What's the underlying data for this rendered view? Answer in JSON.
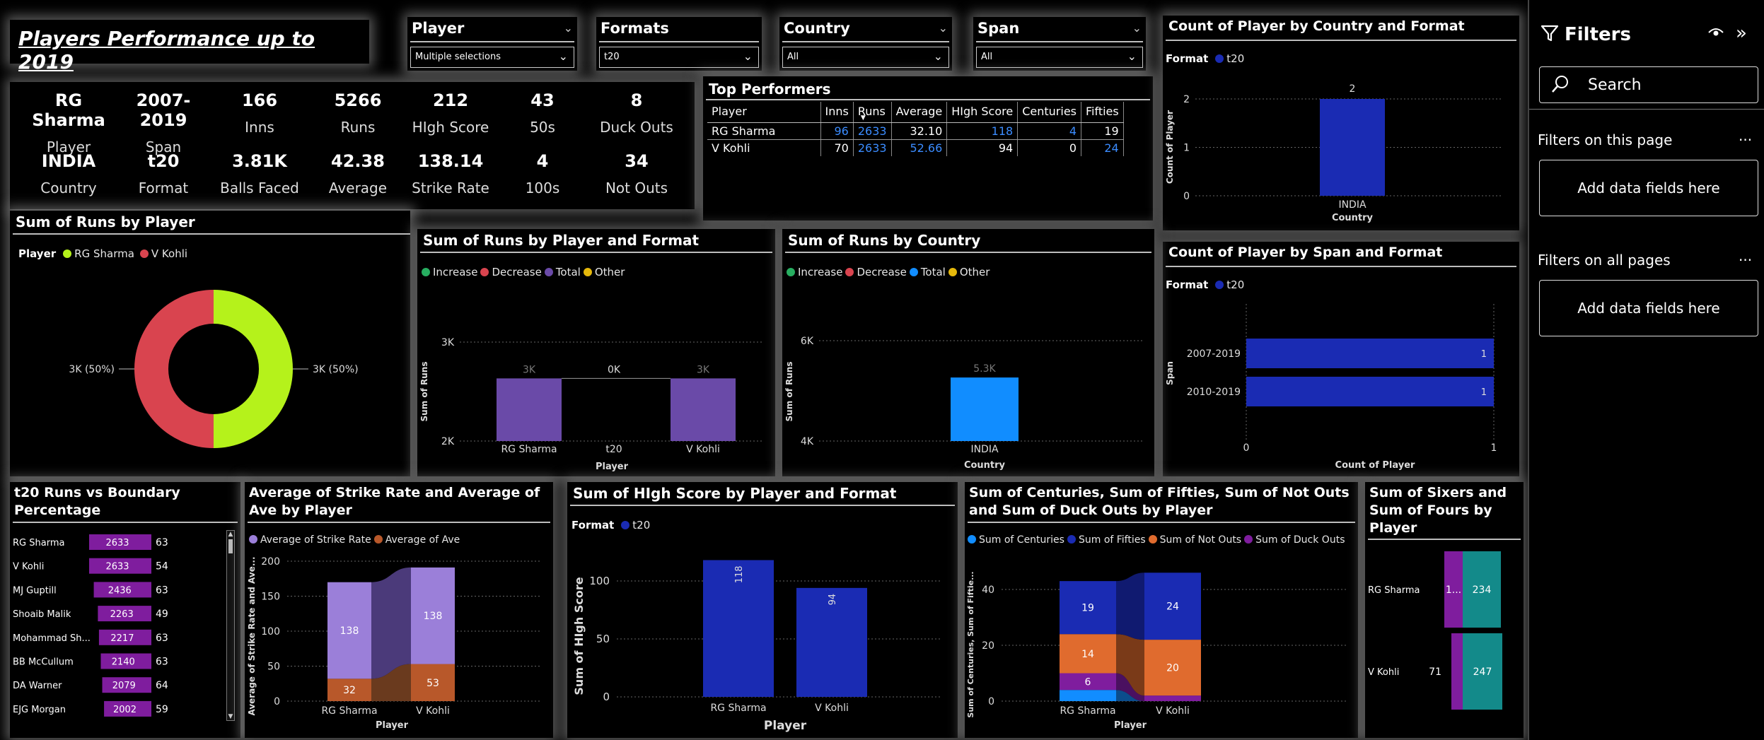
{
  "report_title": "Players Performance up to 2019",
  "slicers": [
    {
      "label": "Player",
      "value": "Multiple selections"
    },
    {
      "label": "Formats",
      "value": "t20"
    },
    {
      "label": "Country",
      "value": "All"
    },
    {
      "label": "Span",
      "value": "All"
    }
  ],
  "kpis_row1": [
    {
      "value": "RG Sharma",
      "label": "Player"
    },
    {
      "value": "2007-2019",
      "label": "Span"
    },
    {
      "value": "166",
      "label": "Inns"
    },
    {
      "value": "5266",
      "label": "Runs"
    },
    {
      "value": "212",
      "label": "HIgh Score"
    },
    {
      "value": "43",
      "label": "50s"
    },
    {
      "value": "8",
      "label": "Duck Outs"
    }
  ],
  "kpis_row2": [
    {
      "value": "INDIA",
      "label": "Country"
    },
    {
      "value": "t20",
      "label": "Format"
    },
    {
      "value": "3.81K",
      "label": "Balls Faced"
    },
    {
      "value": "42.38",
      "label": "Average"
    },
    {
      "value": "138.14",
      "label": "Strike Rate"
    },
    {
      "value": "4",
      "label": "100s"
    },
    {
      "value": "34",
      "label": "Not Outs"
    }
  ],
  "top_performers": {
    "title": "Top Performers",
    "headers": [
      "Player",
      "Inns",
      "Runs",
      "Average",
      "HIgh Score",
      "Centuries",
      "Fifties"
    ],
    "rows": [
      [
        "RG Sharma",
        "96",
        "2633",
        "32.10",
        "118",
        "4",
        "19"
      ],
      [
        "V Kohli",
        "70",
        "2633",
        "52.66",
        "94",
        "0",
        "24"
      ]
    ]
  },
  "filters_pane": {
    "title": "Filters",
    "search_placeholder": "Search",
    "section1": "Filters on this page",
    "section2": "Filters on all pages",
    "add_fields": "Add data fields here",
    "more": "..."
  },
  "colors": {
    "lime": "#b5f21b",
    "red": "#d9444f",
    "navy": "#1a2bb3",
    "purple": "#6a4aa8",
    "azure": "#118dff",
    "magenta": "#7f1d9e",
    "teal": "#138a8a",
    "orange": "#e06b2e",
    "lilac": "#9b7fd9",
    "rust": "#b8582a"
  },
  "chart_data": [
    {
      "id": "runs_by_player",
      "type": "pie",
      "title": "Sum of Runs by Player",
      "legend_title": "Player",
      "labels": [
        "RG Sharma",
        "V Kohli"
      ],
      "values": [
        2633,
        2633
      ],
      "data_labels": [
        "3K (50%)",
        "3K (50%)"
      ]
    },
    {
      "id": "runs_by_player_format",
      "type": "bar",
      "title": "Sum of Runs by Player and Format",
      "legend": [
        "Increase",
        "Decrease",
        "Total",
        "Other"
      ],
      "categories": [
        "RG Sharma",
        "t20",
        "V Kohli"
      ],
      "values": [
        2633,
        0,
        2633
      ],
      "data_labels": [
        "3K",
        "0K",
        "3K"
      ],
      "xlabel": "Player",
      "ylabel": "Sum of Runs",
      "yticks": [
        "2K",
        "3K"
      ],
      "ylim": [
        2000,
        3300
      ]
    },
    {
      "id": "runs_by_country",
      "type": "bar",
      "title": "Sum of Runs by Country",
      "legend": [
        "Increase",
        "Decrease",
        "Total",
        "Other"
      ],
      "categories": [
        "INDIA"
      ],
      "values": [
        5266
      ],
      "data_labels": [
        "5.3K"
      ],
      "xlabel": "Country",
      "ylabel": "Sum of Runs",
      "yticks": [
        "4K",
        "6K"
      ],
      "ylim": [
        4000,
        6200
      ]
    },
    {
      "id": "count_country_format",
      "type": "bar",
      "title": "Count of Player by Country and Format",
      "legend_title": "Format",
      "legend": [
        "t20"
      ],
      "categories": [
        "INDIA"
      ],
      "values": [
        2
      ],
      "xlabel": "Country",
      "ylabel": "Count of Player",
      "yticks": [
        "0",
        "1",
        "2"
      ],
      "ylim": [
        0,
        2
      ]
    },
    {
      "id": "count_span_format",
      "type": "bar",
      "orientation": "horizontal",
      "title": "Count of Player by Span and Format",
      "legend_title": "Format",
      "legend": [
        "t20"
      ],
      "categories": [
        "2007-2019",
        "2010-2019"
      ],
      "values": [
        1,
        1
      ],
      "xlabel": "Count of Player",
      "ylabel": "Span",
      "xticks": [
        "0",
        "1"
      ],
      "xlim": [
        0,
        1
      ]
    },
    {
      "id": "t20_runs_boundary",
      "type": "table",
      "title": "t20 Runs vs Boundary Percentage",
      "rows": [
        {
          "player": "RG Sharma",
          "runs": 2633,
          "pct": 63
        },
        {
          "player": "V Kohli",
          "runs": 2633,
          "pct": 54
        },
        {
          "player": "MJ Guptill",
          "runs": 2436,
          "pct": 63
        },
        {
          "player": "Shoaib Malik",
          "runs": 2263,
          "pct": 49
        },
        {
          "player": "Mohammad Sh...",
          "runs": 2217,
          "pct": 63
        },
        {
          "player": "BB McCullum",
          "runs": 2140,
          "pct": 63
        },
        {
          "player": "DA Warner",
          "runs": 2079,
          "pct": 64
        },
        {
          "player": "EJG Morgan",
          "runs": 2002,
          "pct": 59
        }
      ]
    },
    {
      "id": "sr_avg_by_player",
      "type": "bar",
      "stacked": true,
      "title": "Average of Strike Rate and Average of Ave by Player",
      "categories": [
        "RG Sharma",
        "V Kohli"
      ],
      "series": [
        {
          "name": "Average of Strike Rate",
          "values": [
            138,
            138
          ]
        },
        {
          "name": "Average of Ave",
          "values": [
            32,
            53
          ]
        }
      ],
      "xlabel": "Player",
      "ylabel": "Average of Strike Rate and Ave...",
      "yticks": [
        "0",
        "50",
        "100",
        "150",
        "200"
      ],
      "ylim": [
        0,
        200
      ]
    },
    {
      "id": "high_score_by_player",
      "type": "bar",
      "title": "Sum of HIgh Score by Player and Format",
      "legend_title": "Format",
      "legend": [
        "t20"
      ],
      "categories": [
        "RG Sharma",
        "V Kohli"
      ],
      "values": [
        118,
        94
      ],
      "xlabel": "Player",
      "ylabel": "Sum of HIgh Score",
      "yticks": [
        "0",
        "50",
        "100"
      ],
      "ylim": [
        0,
        125
      ]
    },
    {
      "id": "centuries_fifties",
      "type": "bar",
      "stacked": true,
      "title": "Sum of Centuries, Sum of Fifties, Sum of Not Outs and Sum of Duck Outs by Player",
      "categories": [
        "RG Sharma",
        "V Kohli"
      ],
      "series": [
        {
          "name": "Sum of Centuries",
          "values": [
            4,
            0
          ]
        },
        {
          "name": "Sum of Fifties",
          "values": [
            19,
            24
          ]
        },
        {
          "name": "Sum of Not Outs",
          "values": [
            14,
            20
          ]
        },
        {
          "name": "Sum of Duck Outs",
          "values": [
            6,
            2
          ]
        }
      ],
      "xlabel": "Player",
      "ylabel": "Sum of Centuries, Sum of Fiftie...",
      "yticks": [
        "0",
        "20",
        "40"
      ],
      "ylim": [
        0,
        50
      ]
    },
    {
      "id": "sixers_fours",
      "type": "bar",
      "orientation": "horizontal",
      "stacked": true,
      "title": "Sum of Sixers and Sum of Fours by Player",
      "categories": [
        "RG Sharma",
        "V Kohli"
      ],
      "series": [
        {
          "name": "Sum of Sixers",
          "values": [
            120,
            71
          ],
          "labels": [
            "1...",
            "71"
          ]
        },
        {
          "name": "Sum of Fours",
          "values": [
            234,
            247
          ]
        }
      ]
    }
  ]
}
